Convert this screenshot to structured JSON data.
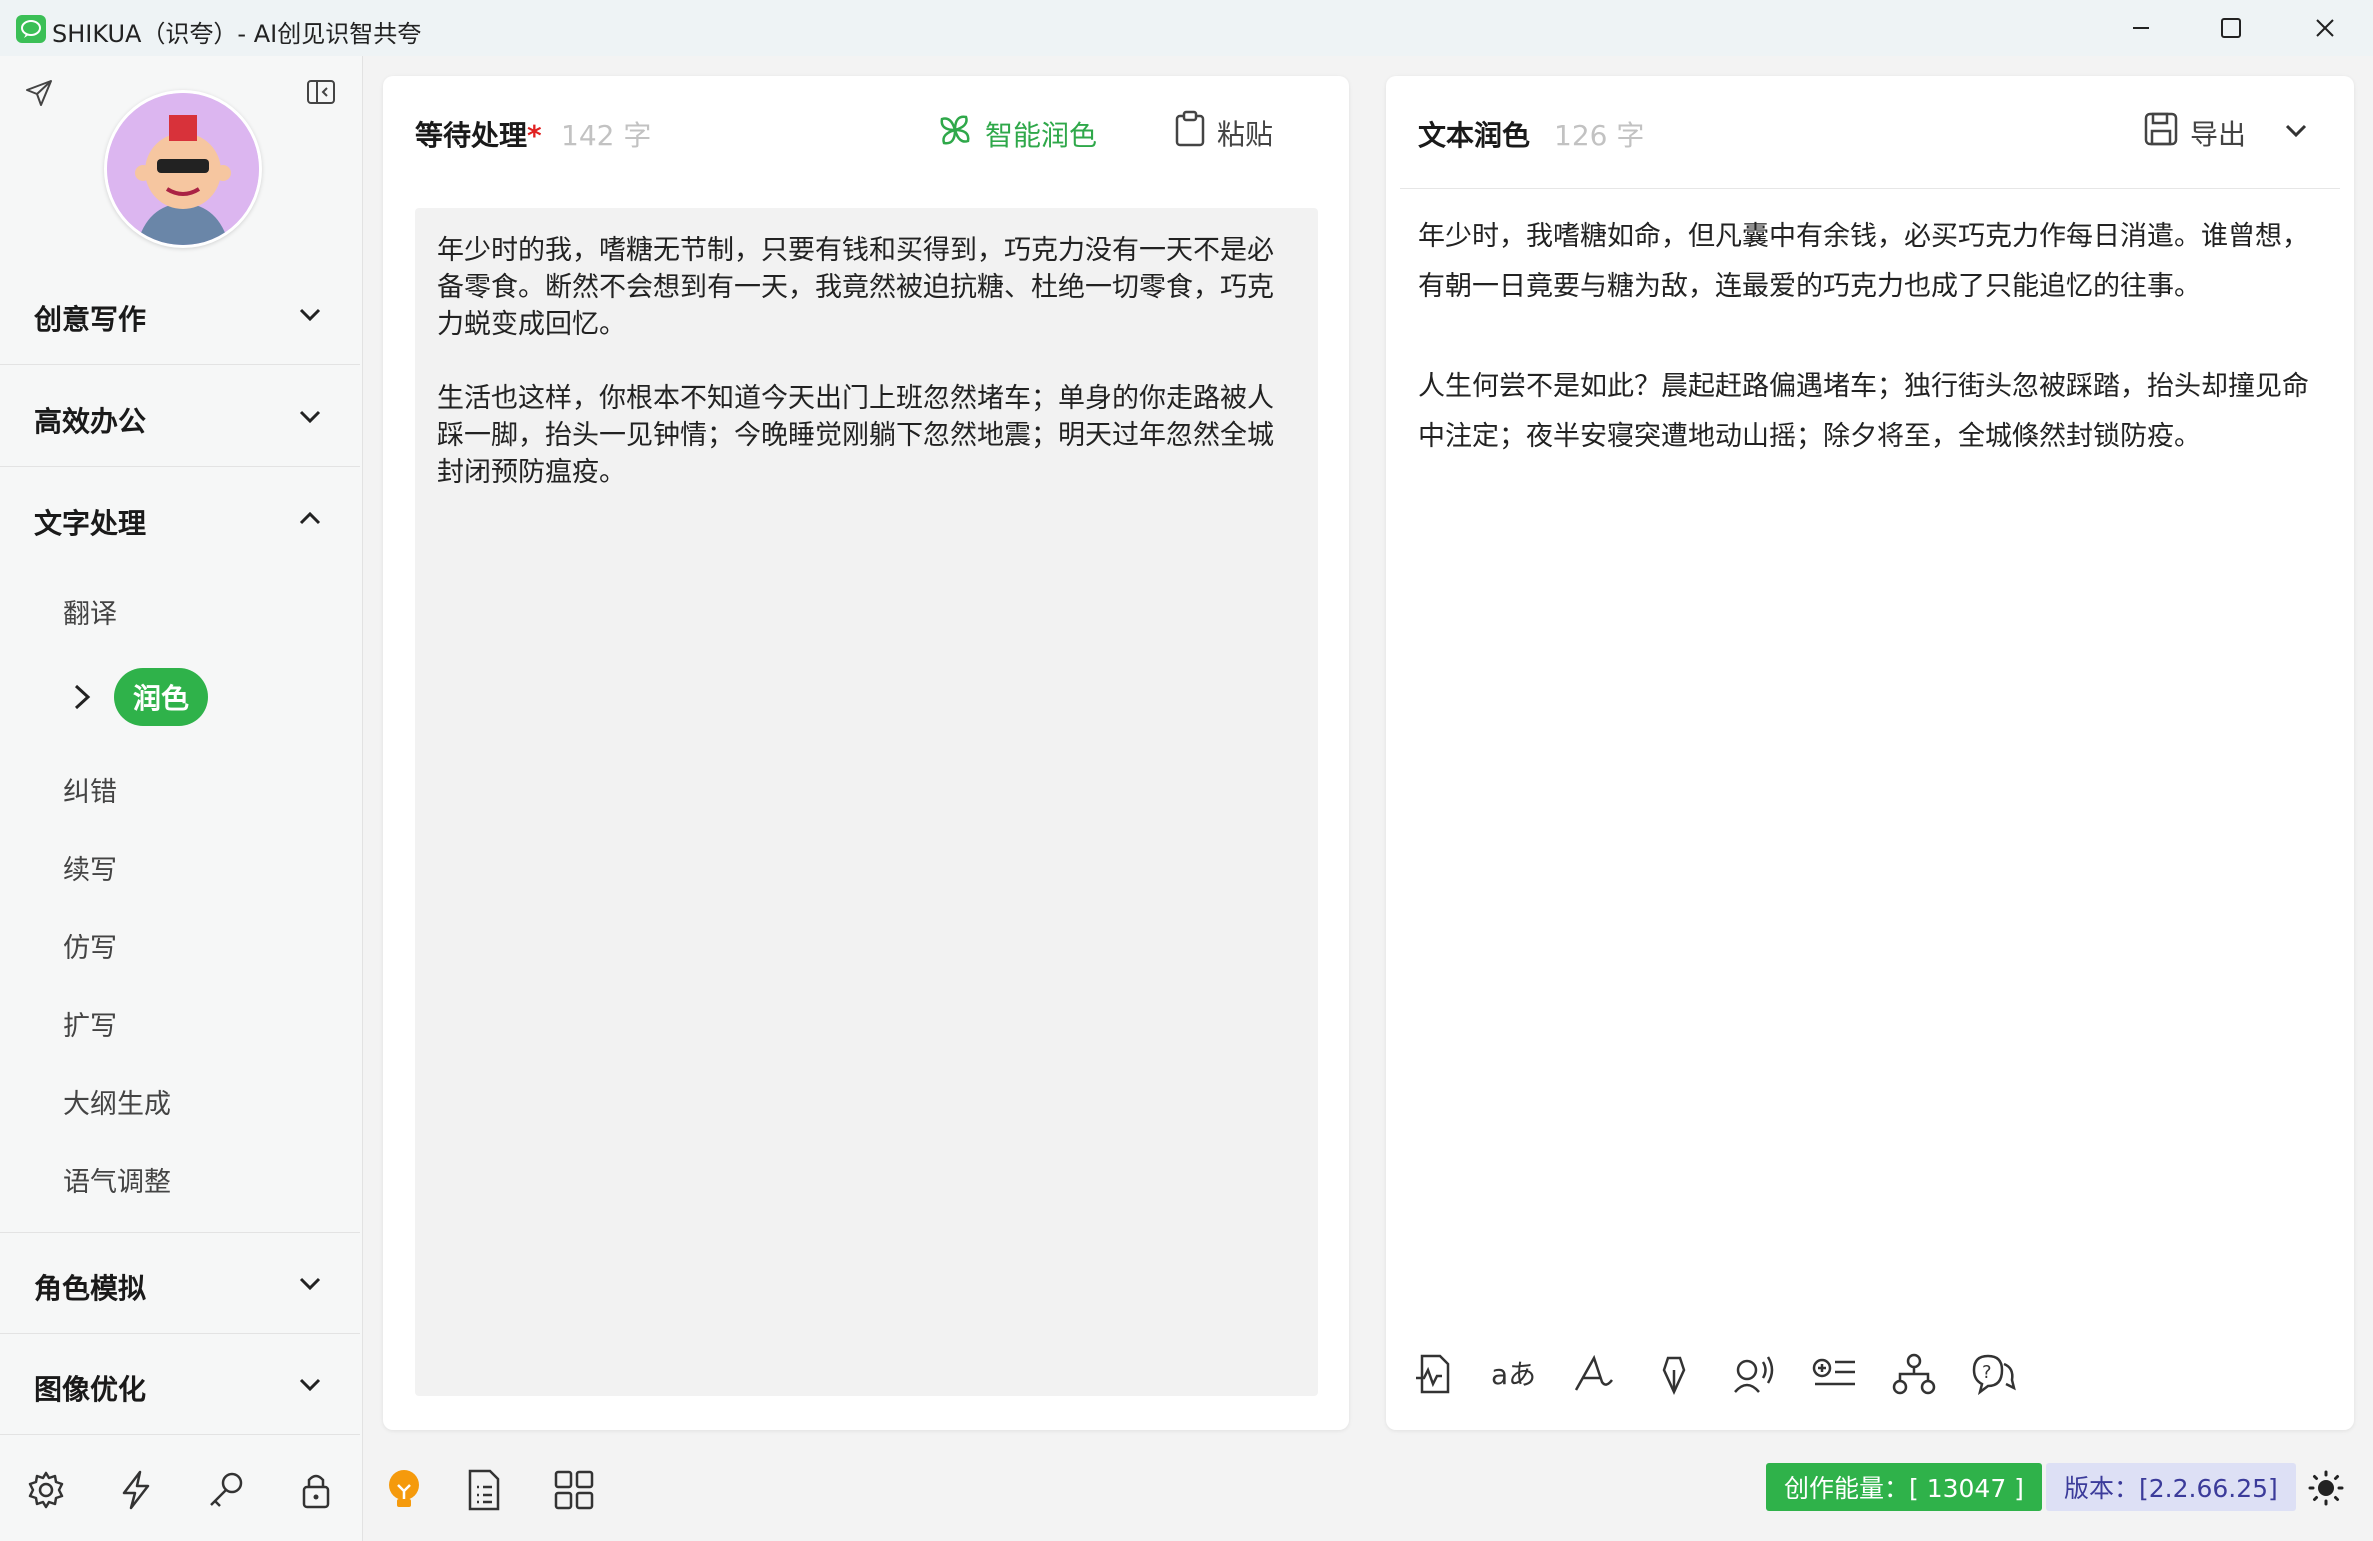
{
  "window": {
    "title": "SHIKUA（识夸）- AI创见识智共夸"
  },
  "sidebar": {
    "sections": [
      {
        "label": "创意写作",
        "expanded": false
      },
      {
        "label": "高效办公",
        "expanded": false
      },
      {
        "label": "文字处理",
        "expanded": true
      },
      {
        "label": "角色模拟",
        "expanded": false
      },
      {
        "label": "图像优化",
        "expanded": false
      }
    ],
    "text_items": [
      "翻译",
      "润色",
      "纠错",
      "续写",
      "仿写",
      "扩写",
      "大纲生成",
      "语气调整"
    ],
    "active_item": "润色"
  },
  "input_panel": {
    "title": "等待处理",
    "required_mark": "*",
    "count": "142 字",
    "smart_polish": "智能润色",
    "paste": "粘贴",
    "text": "年少时的我，嗜糖无节制，只要有钱和买得到，巧克力没有一天不是必备零食。断然不会想到有一天，我竟然被迫抗糖、杜绝一切零食，巧克力蜕变成回忆。\n\n生活也这样，你根本不知道今天出门上班忽然堵车；单身的你走路被人踩一脚，抬头一见钟情；今晚睡觉刚躺下忽然地震；明天过年忽然全城封闭预防瘟疫。"
  },
  "output_panel": {
    "title": "文本润色",
    "count": "126 字",
    "export": "导出",
    "text": "年少时，我嗜糖如命，但凡囊中有余钱，必买巧克力作每日消遣。谁曾想，有朝一日竟要与糖为敌，连最爱的巧克力也成了只能追忆的往事。\n\n人生何尝不是如此？晨起赶路偏遇堵车；独行街头忽被踩踏，抬头却撞见命中注定；夜半安寝突遭地动山摇；除夕将至，全城倏然封锁防疫。"
  },
  "status": {
    "energy": "创作能量：[ 13047 ]",
    "version": "版本：[2.2.66.25]"
  },
  "colors": {
    "accent": "#2fb24a",
    "version_bg": "#dde0f5"
  }
}
